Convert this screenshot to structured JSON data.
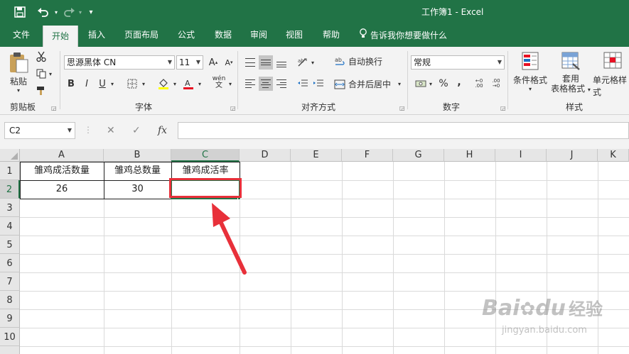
{
  "window": {
    "title": "工作簿1  -  Excel",
    "quick_access": [
      "save-icon",
      "undo-icon",
      "redo-icon",
      "customize-icon"
    ]
  },
  "menu_tabs": [
    {
      "label": "文件"
    },
    {
      "label": "开始"
    },
    {
      "label": "插入"
    },
    {
      "label": "页面布局"
    },
    {
      "label": "公式"
    },
    {
      "label": "数据"
    },
    {
      "label": "审阅"
    },
    {
      "label": "视图"
    },
    {
      "label": "帮助"
    },
    {
      "label": "告诉我你想要做什么"
    }
  ],
  "ribbon": {
    "clipboard": {
      "paste_label": "粘贴",
      "group_label": "剪贴板"
    },
    "font": {
      "name": "思源黑体 CN",
      "size": "11",
      "group_label": "字体",
      "bold": "B",
      "italic": "I",
      "underline": "U",
      "phonetic": "wén",
      "grow": "A",
      "shrink": "A"
    },
    "alignment": {
      "wrap_text": "自动换行",
      "merge_center": "合并后居中",
      "group_label": "对齐方式"
    },
    "number": {
      "format": "常规",
      "group_label": "数字",
      "percent": "%",
      "comma": ","
    },
    "styles": {
      "conditional": "条件格式",
      "table_line1": "套用",
      "table_line2": "表格格式",
      "cell_styles": "单元格样式",
      "group_label": "样式"
    }
  },
  "formula_bar": {
    "name_box": "C2",
    "cancel": "✕",
    "enter": "✓",
    "fx": "fx",
    "value": ""
  },
  "sheet": {
    "selected_cell": "C2",
    "columns": [
      "A",
      "B",
      "C",
      "D",
      "E",
      "F",
      "G",
      "H",
      "I",
      "J",
      "K"
    ],
    "rows": [
      "1",
      "2",
      "3",
      "4",
      "5",
      "6",
      "7",
      "8",
      "9",
      "10"
    ],
    "cells": {
      "A1": "雏鸡成活数量",
      "B1": "雏鸡总数量",
      "C1": "雏鸡成活率",
      "A2": "26",
      "B2": "30",
      "C2": ""
    }
  },
  "annotation": {
    "box_color": "#e8303a",
    "arrow_color": "#e8303a"
  },
  "watermark": {
    "brand": "Bai",
    "brand2": "du",
    "text": "经验",
    "url": "jingyan.baidu.com"
  },
  "colors": {
    "accent": "#217346",
    "ribbon_bg": "#f3f3f3"
  }
}
